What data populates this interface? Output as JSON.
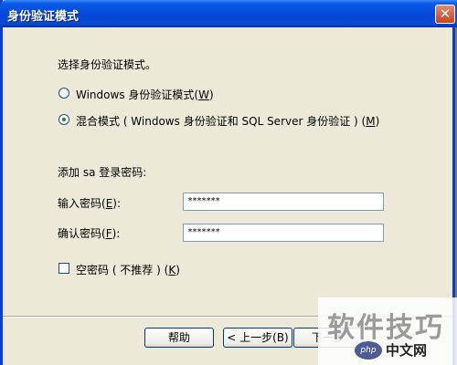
{
  "window": {
    "title": "身份验证模式",
    "close_symbol": "✕"
  },
  "prompt": "选择身份验证模式。",
  "auth_options": [
    {
      "label_before": "Windows 身份验证模式(",
      "accel": "W",
      "label_after": ")",
      "checked": false
    },
    {
      "label_before": "混合模式 ( Windows 身份验证和 SQL Server 身份验证 ) (",
      "accel": "M",
      "label_after": ")",
      "checked": true
    }
  ],
  "sa_section": {
    "heading": "添加 sa 登录密码:",
    "enter_label_before": "输入密码(",
    "enter_accel": "E",
    "enter_label_after": "):",
    "enter_value": "*******",
    "confirm_label_before": "确认密码(",
    "confirm_accel": "F",
    "confirm_label_after": "):",
    "confirm_value": "*******"
  },
  "blank_password": {
    "label_before": "空密码 ( 不推荐 ) (",
    "accel": "K",
    "label_after": ")",
    "checked": false
  },
  "buttons": {
    "help": "帮助",
    "back": "< 上一步(B)",
    "next": "下一步"
  },
  "watermark": {
    "text": "软件技巧",
    "logo": "php",
    "site": "中文网"
  },
  "colors": {
    "titlebar": "#0546d8",
    "dialog_bg": "#ece9d8"
  }
}
